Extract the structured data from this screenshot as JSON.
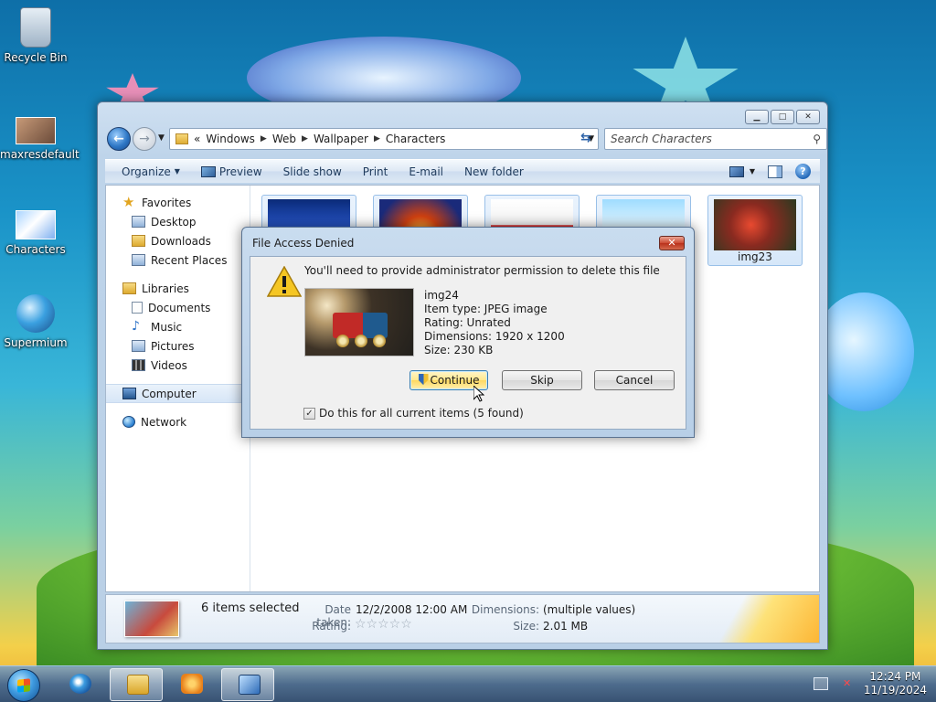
{
  "desktop": {
    "icons": [
      {
        "label": "Recycle Bin",
        "icon": "recycle-bin-icon"
      },
      {
        "label": "maxresdefault",
        "icon": "image-file-icon"
      },
      {
        "label": "Characters",
        "icon": "image-file-icon"
      },
      {
        "label": "Supermium",
        "icon": "browser-icon"
      }
    ]
  },
  "explorer": {
    "breadcrumb": [
      "Windows",
      "Web",
      "Wallpaper",
      "Characters"
    ],
    "breadcrumb_prefix": "«",
    "search_placeholder": "Search Characters",
    "toolbar": {
      "organize": "Organize",
      "preview": "Preview",
      "slideshow": "Slide show",
      "print": "Print",
      "email": "E-mail",
      "new_folder": "New folder"
    },
    "nav": {
      "favorites": "Favorites",
      "desktop": "Desktop",
      "downloads": "Downloads",
      "recent_places": "Recent Places",
      "libraries": "Libraries",
      "documents": "Documents",
      "music": "Music",
      "pictures": "Pictures",
      "videos": "Videos",
      "computer": "Computer",
      "network": "Network"
    },
    "files": [
      {
        "label": ""
      },
      {
        "label": ""
      },
      {
        "label": ""
      },
      {
        "label": ""
      },
      {
        "label": "img23"
      }
    ],
    "details": {
      "count": "6 items selected",
      "date_taken_label": "Date taken:",
      "date_taken": "12/2/2008 12:00 AM",
      "rating_label": "Rating:",
      "rating_stars": "☆☆☆☆☆",
      "dimensions_label": "Dimensions:",
      "dimensions": "(multiple values)",
      "size_label": "Size:",
      "size": "2.01 MB"
    }
  },
  "dialog": {
    "title": "File Access Denied",
    "close": "✕",
    "message": "You'll need to provide administrator permission to delete this file",
    "file": {
      "name": "img24",
      "type": "Item type: JPEG image",
      "rating": "Rating: Unrated",
      "dimensions": "Dimensions: 1920 x 1200",
      "size": "Size: 230 KB"
    },
    "buttons": {
      "continue": "Continue",
      "skip": "Skip",
      "cancel": "Cancel"
    },
    "checkbox_label": "Do this for all current items (5 found)",
    "checkbox_checked": true
  },
  "taskbar": {
    "time": "12:24 PM",
    "date": "11/19/2024"
  }
}
